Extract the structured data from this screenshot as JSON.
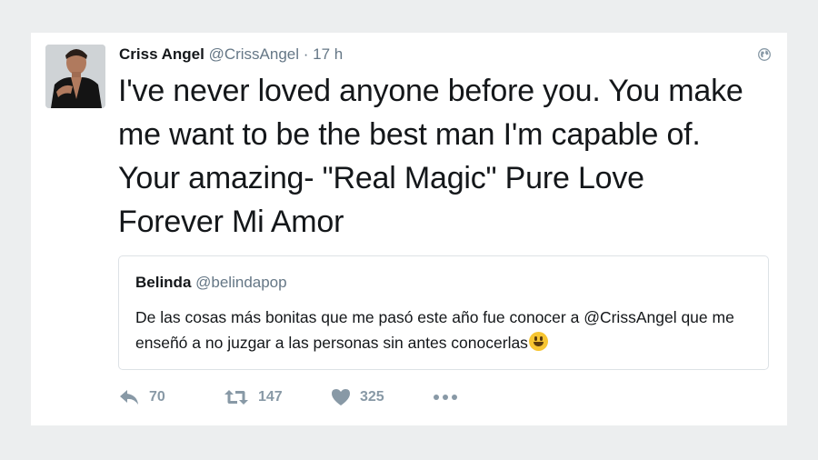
{
  "tweet": {
    "author_name": "Criss Angel",
    "handle": "@CrissAngel",
    "separator": "·",
    "time": "17 h",
    "text": "I've never loved anyone before you. You make me want to be the best man I'm capable of. Your amazing- \"Real Magic\" Pure Love Forever Mi Amor",
    "quoted": {
      "author_name": "Belinda",
      "handle": "@belindapop",
      "text": "De las cosas más bonitas que me pasó este año fue conocer a @CrissAngel que me enseñó a no juzgar a las personas sin antes conocerlas",
      "emoji": "grinning-face-emoji"
    },
    "actions": {
      "reply": {
        "icon": "reply-icon",
        "count": "70"
      },
      "retweet": {
        "icon": "retweet-icon",
        "count": "147"
      },
      "like": {
        "icon": "heart-icon",
        "count": "325"
      },
      "more": {
        "icon": "more-icon"
      }
    },
    "visibility_icon": "globe-icon"
  },
  "colors": {
    "background": "#eceeef",
    "card": "#ffffff",
    "text": "#14171a",
    "muted": "#657786",
    "icon": "#8899a6",
    "quote_border": "#dde2e6"
  }
}
